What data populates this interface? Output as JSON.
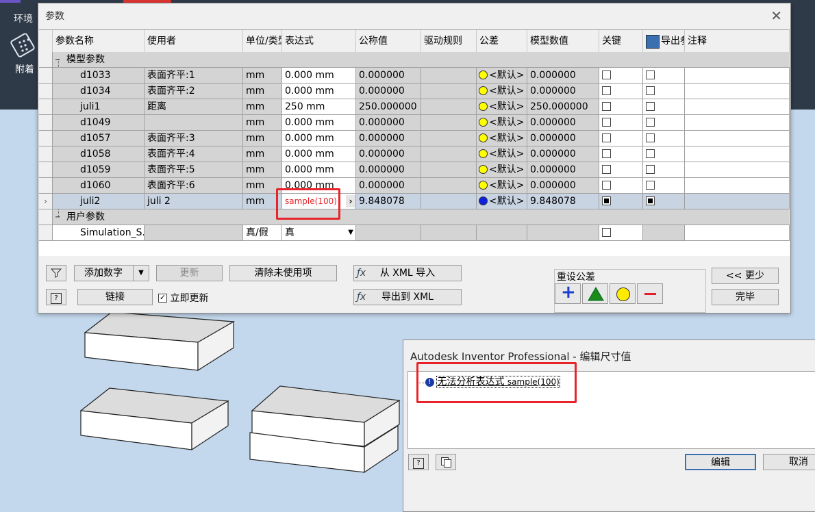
{
  "appbar": {
    "menu": "环境",
    "tool_label": "附着"
  },
  "params_dialog": {
    "title": "参数",
    "close_glyph": "✕",
    "columns": [
      "参数名称",
      "使用者",
      "单位/类型",
      "表达式",
      "公称值",
      "驱动规则",
      "公差",
      "模型数值",
      "关键",
      "导出参数",
      "注释"
    ],
    "section_model": "模型参数",
    "section_user": "用户参数",
    "rows": [
      {
        "name": "d1033",
        "user": "表面齐平:1",
        "unit": "mm",
        "expr": "0.000 mm",
        "nominal": "0.000000",
        "tol": "<默认>",
        "model": "0.000000"
      },
      {
        "name": "d1034",
        "user": "表面齐平:2",
        "unit": "mm",
        "expr": "0.000 mm",
        "nominal": "0.000000",
        "tol": "<默认>",
        "model": "0.000000"
      },
      {
        "name": "juli1",
        "user": "距离",
        "unit": "mm",
        "expr": "250 mm",
        "nominal": "250.000000",
        "tol": "<默认>",
        "model": "250.000000"
      },
      {
        "name": "d1049",
        "user": "",
        "unit": "mm",
        "expr": "0.000 mm",
        "nominal": "0.000000",
        "tol": "<默认>",
        "model": "0.000000"
      },
      {
        "name": "d1057",
        "user": "表面齐平:3",
        "unit": "mm",
        "expr": "0.000 mm",
        "nominal": "0.000000",
        "tol": "<默认>",
        "model": "0.000000"
      },
      {
        "name": "d1058",
        "user": "表面齐平:4",
        "unit": "mm",
        "expr": "0.000 mm",
        "nominal": "0.000000",
        "tol": "<默认>",
        "model": "0.000000"
      },
      {
        "name": "d1059",
        "user": "表面齐平:5",
        "unit": "mm",
        "expr": "0.000 mm",
        "nominal": "0.000000",
        "tol": "<默认>",
        "model": "0.000000"
      },
      {
        "name": "d1060",
        "user": "表面齐平:6",
        "unit": "mm",
        "expr": "0.000 mm",
        "nominal": "0.000000",
        "tol": "<默认>",
        "model": "0.000000"
      }
    ],
    "selected_row": {
      "marker": "›",
      "name": "juli2",
      "user": "juli 2",
      "unit": "mm",
      "expr": "sample(100)",
      "arrow": "›",
      "nominal": "9.848078",
      "tol": "<默认>",
      "model": "9.848078"
    },
    "user_row": {
      "name": "Simulation_S...",
      "unit": "真/假",
      "expr": "真"
    },
    "buttons": {
      "add_number": "添加数字",
      "update": "更新",
      "purge": "清除未使用项",
      "import_xml": "从 XML 导入",
      "export_xml": "导出到 XML",
      "link": "链接",
      "immediate_update": "立即更新",
      "less": "<< 更少",
      "done": "完毕"
    },
    "reset_tolerance_label": "重设公差",
    "colors": {
      "yellow": "#ffff00",
      "blue": "#1020e0",
      "red_highlight": "#e8242a"
    }
  },
  "error_dialog": {
    "title": "Autodesk Inventor Professional - 编辑尺寸值",
    "message_cn": "无法分析表达式",
    "message_expr": "sample(100)",
    "edit": "编辑",
    "cancel": "取消"
  }
}
